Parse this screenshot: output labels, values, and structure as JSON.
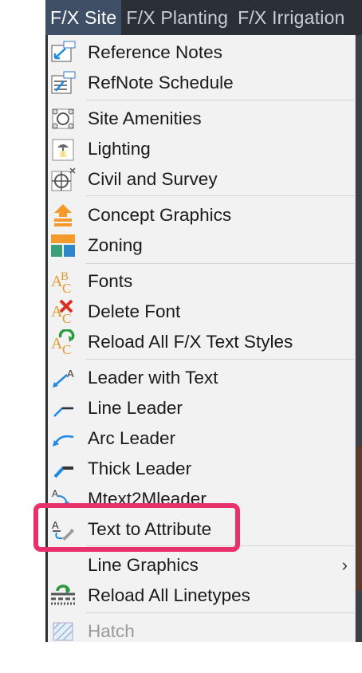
{
  "menubar": {
    "tabs": [
      {
        "label": "F/X Site",
        "active": true
      },
      {
        "label": "F/X Planting",
        "active": false
      },
      {
        "label": "F/X Irrigation",
        "active": false
      }
    ]
  },
  "menu": {
    "items": [
      {
        "label": "Reference Notes",
        "icon": "reference-notes-icon"
      },
      {
        "label": "RefNote Schedule",
        "icon": "refnote-schedule-icon"
      },
      {
        "label": "Site Amenities",
        "icon": "site-amenities-icon"
      },
      {
        "label": "Lighting",
        "icon": "lighting-icon"
      },
      {
        "label": "Civil and Survey",
        "icon": "civil-survey-icon"
      },
      {
        "label": "Concept Graphics",
        "icon": "concept-graphics-icon"
      },
      {
        "label": "Zoning",
        "icon": "zoning-icon"
      },
      {
        "label": "Fonts",
        "icon": "fonts-icon"
      },
      {
        "label": "Delete Font",
        "icon": "delete-font-icon"
      },
      {
        "label": "Reload All F/X Text Styles",
        "icon": "reload-text-styles-icon"
      },
      {
        "label": "Leader with Text",
        "icon": "leader-with-text-icon"
      },
      {
        "label": "Line Leader",
        "icon": "line-leader-icon"
      },
      {
        "label": "Arc Leader",
        "icon": "arc-leader-icon"
      },
      {
        "label": "Thick Leader",
        "icon": "thick-leader-icon"
      },
      {
        "label": "Mtext2Mleader",
        "icon": "mtext2mleader-icon"
      },
      {
        "label": "Text to Attribute",
        "icon": "text-to-attribute-icon",
        "highlighted": true
      },
      {
        "label": "Line Graphics",
        "icon": "",
        "submenu": true,
        "submenu_glyph": "›"
      },
      {
        "label": "Reload All Linetypes",
        "icon": "reload-linetypes-icon"
      },
      {
        "label": "Hatch",
        "icon": "hatch-icon",
        "disabled": true
      }
    ]
  },
  "colors": {
    "highlight": "#e8316b",
    "menubar_bg": "#2b2f36",
    "active_tab_bg": "#3e4f66"
  }
}
